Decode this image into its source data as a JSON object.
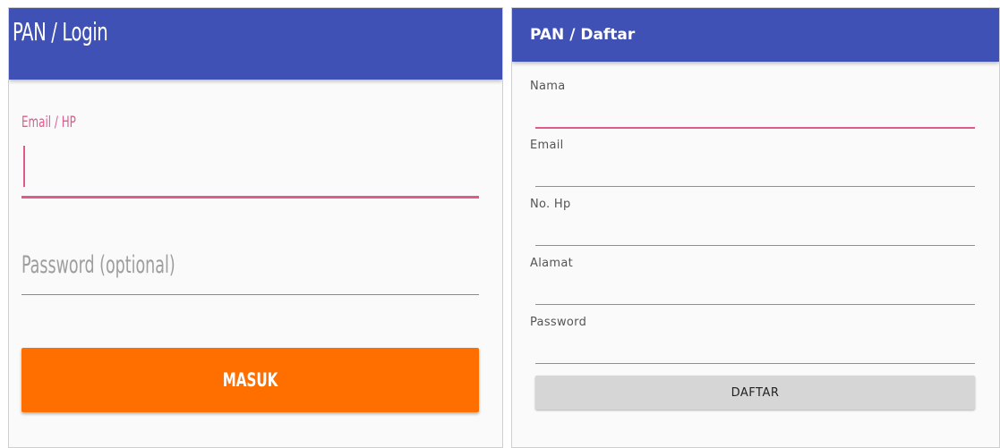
{
  "colors": {
    "appbar": "#3f51b5",
    "accent_pink": "#e05b8c",
    "button_orange": "#ff6f00",
    "button_gray": "#d6d6d6",
    "background": "#fafafa"
  },
  "login": {
    "title": "PAN / Login",
    "email_label": "Email / HP",
    "email_value": "",
    "password_placeholder": "Password (optional)",
    "submit_label": "MASUK"
  },
  "daftar": {
    "title": "PAN / Daftar",
    "fields": [
      {
        "label": "Nama",
        "value": "",
        "active": true
      },
      {
        "label": "Email",
        "value": "",
        "active": false
      },
      {
        "label": "No. Hp",
        "value": "",
        "active": false
      },
      {
        "label": "Alamat",
        "value": "",
        "active": false
      },
      {
        "label": "Password",
        "value": "",
        "active": false
      }
    ],
    "submit_label": "DAFTAR"
  }
}
